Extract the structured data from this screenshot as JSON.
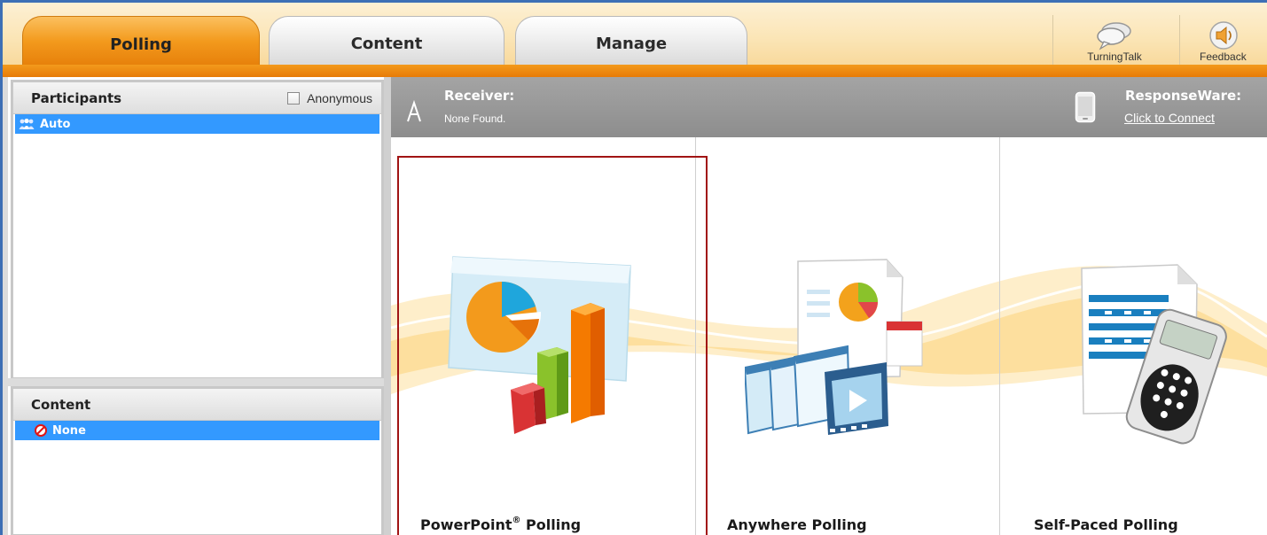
{
  "tabs": [
    {
      "label": "Polling",
      "active": true
    },
    {
      "label": "Content",
      "active": false
    },
    {
      "label": "Manage",
      "active": false
    }
  ],
  "tools": {
    "turningtalk": {
      "label": "TurningTalk",
      "icon": "speech-bubbles-icon"
    },
    "feedback": {
      "label": "Feedback",
      "icon": "speaker-icon"
    }
  },
  "participants": {
    "title": "Participants",
    "anonymous_label": "Anonymous",
    "anonymous_checked": false,
    "items": [
      {
        "label": "Auto",
        "icon": "group-icon",
        "selected": true
      }
    ]
  },
  "content": {
    "title": "Content",
    "items": [
      {
        "label": "None",
        "icon": "no-entry-icon",
        "selected": true
      }
    ]
  },
  "status": {
    "receiver_label": "Receiver:",
    "receiver_value": "None Found.",
    "responseware_label": "ResponseWare:",
    "responseware_link": "Click to Connect"
  },
  "modes": [
    {
      "label": "PowerPoint",
      "mark": "®",
      "suffix": " Polling",
      "selected": true
    },
    {
      "label": "Anywhere Polling",
      "selected": false
    },
    {
      "label": "Self-Paced Polling",
      "selected": false
    }
  ],
  "colors": {
    "accent_orange": "#f39a1c",
    "selection_blue": "#3399ff",
    "selected_outline": "#a11414",
    "status_gray": "#999999"
  }
}
